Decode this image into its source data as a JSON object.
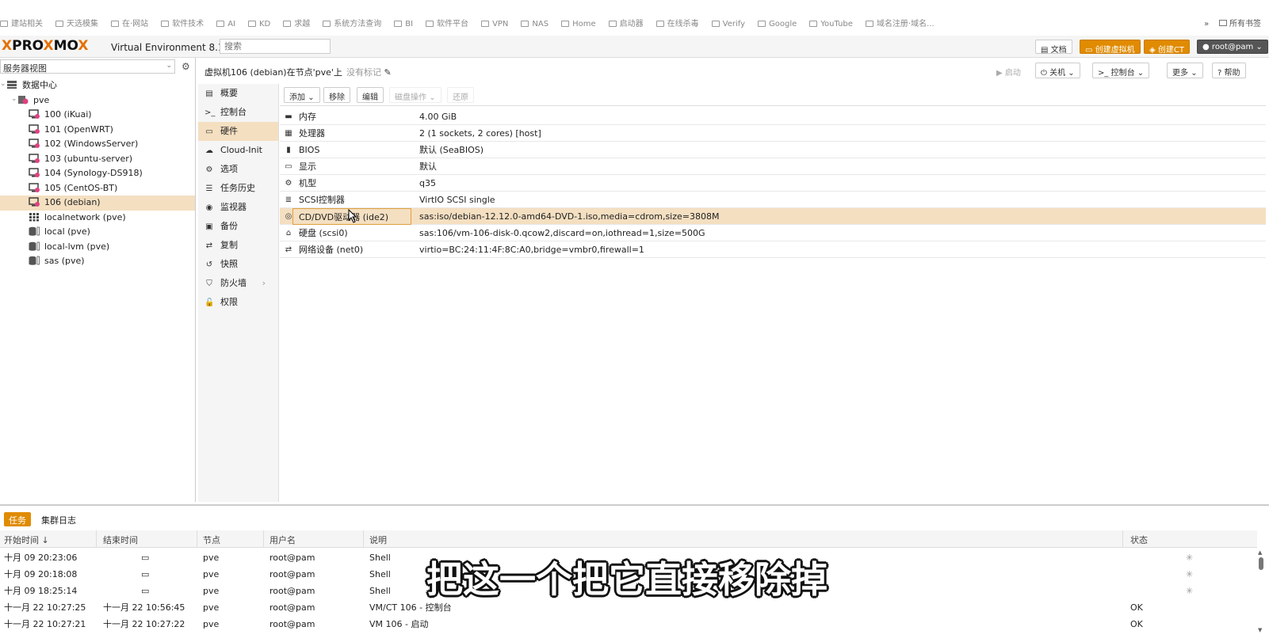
{
  "bookmarks": {
    "items": [
      "建站相关",
      "天选模集",
      "在·网站",
      "软件技术",
      "AI",
      "KD",
      "求越",
      "系统方法查询",
      "BI",
      "软件平台",
      "VPN",
      "NAS",
      "Home",
      "启动器",
      "在线杀毒",
      "Verify",
      "Google",
      "YouTube",
      "域名注册·域名..."
    ],
    "more": "»",
    "all_label": "所有书签"
  },
  "header": {
    "logo_prefix": "PRO",
    "logo_x1": "X",
    "logo_mid": "MO",
    "logo_x2": "X",
    "logo_lead": "X",
    "product": "Virtual Environment 8.1.4",
    "search_placeholder": "搜索",
    "doc_label": "文档",
    "create_vm_label": "创建虚拟机",
    "create_ct_label": "创建CT",
    "user_label": "root@pam"
  },
  "left": {
    "view_label": "服务器视图",
    "tree": [
      {
        "label": "数据中心",
        "icon": "datacenter-icon",
        "level": 0
      },
      {
        "label": "pve",
        "icon": "node-icon",
        "level": 1
      },
      {
        "label": "100 (iKuai)",
        "icon": "vm-icon",
        "level": 2
      },
      {
        "label": "101 (OpenWRT)",
        "icon": "vm-icon",
        "level": 2
      },
      {
        "label": "102 (WindowsServer)",
        "icon": "vm-icon",
        "level": 2
      },
      {
        "label": "103 (ubuntu-server)",
        "icon": "vm-icon",
        "level": 2
      },
      {
        "label": "104 (Synology-DS918)",
        "icon": "vm-icon",
        "level": 2
      },
      {
        "label": "105 (CentOS-BT)",
        "icon": "vm-icon",
        "level": 2
      },
      {
        "label": "106 (debian)",
        "icon": "vm-icon",
        "level": 2,
        "selected": true
      },
      {
        "label": "localnetwork (pve)",
        "icon": "network-icon",
        "level": 2
      },
      {
        "label": "local (pve)",
        "icon": "storage-icon",
        "level": 2
      },
      {
        "label": "local-lvm (pve)",
        "icon": "storage-icon",
        "level": 2
      },
      {
        "label": "sas (pve)",
        "icon": "storage-icon",
        "level": 2
      }
    ]
  },
  "content": {
    "title": "虚拟机106 (debian)在节点'pve'上",
    "no_tags": "没有标记",
    "start_label": "启动",
    "shutdown_label": "关机",
    "console_label": "控制台",
    "more_label": "更多",
    "help_label": "帮助"
  },
  "menu": [
    {
      "label": "概要",
      "icon": "summary-icon",
      "glyph": "▤"
    },
    {
      "label": "控制台",
      "icon": "console-icon",
      "glyph": ">_"
    },
    {
      "label": "硬件",
      "icon": "hardware-icon",
      "glyph": "▭",
      "selected": true
    },
    {
      "label": "Cloud-Init",
      "icon": "cloud-icon",
      "glyph": "☁"
    },
    {
      "label": "选项",
      "icon": "gear-icon",
      "glyph": "⚙"
    },
    {
      "label": "任务历史",
      "icon": "list-icon",
      "glyph": "☰"
    },
    {
      "label": "监视器",
      "icon": "eye-icon",
      "glyph": "◉"
    },
    {
      "label": "备份",
      "icon": "save-icon",
      "glyph": "▣"
    },
    {
      "label": "复制",
      "icon": "retweet-icon",
      "glyph": "⇄"
    },
    {
      "label": "快照",
      "icon": "history-icon",
      "glyph": "↺"
    },
    {
      "label": "防火墙",
      "icon": "shield-icon",
      "glyph": "⛉"
    },
    {
      "label": "权限",
      "icon": "unlock-icon",
      "glyph": "🔓"
    }
  ],
  "hardware": {
    "toolbar": {
      "add": "添加",
      "remove": "移除",
      "edit": "编辑",
      "disk_action": "磁盘操作",
      "revert": "还原"
    },
    "rows": [
      {
        "key": "内存",
        "value": "4.00 GiB",
        "icon": "memory-icon",
        "glyph": "▬"
      },
      {
        "key": "处理器",
        "value": "2 (1 sockets, 2 cores) [host]",
        "icon": "cpu-icon",
        "glyph": "▦"
      },
      {
        "key": "BIOS",
        "value": "默认 (SeaBIOS)",
        "icon": "bios-icon",
        "glyph": "▮"
      },
      {
        "key": "显示",
        "value": "默认",
        "icon": "display-icon",
        "glyph": "▭"
      },
      {
        "key": "机型",
        "value": "q35",
        "icon": "cogs-icon",
        "glyph": "⚙"
      },
      {
        "key": "SCSI控制器",
        "value": "VirtIO SCSI single",
        "icon": "database-icon",
        "glyph": "≣"
      },
      {
        "key": "CD/DVD驱动器 (ide2)",
        "value": "sas:iso/debian-12.12.0-amd64-DVD-1.iso,media=cdrom,size=3808M",
        "icon": "cdrom-icon",
        "glyph": "◎",
        "selected": true
      },
      {
        "key": "硬盘 (scsi0)",
        "value": "sas:106/vm-106-disk-0.qcow2,discard=on,iothread=1,size=500G",
        "icon": "harddisk-icon",
        "glyph": "⌂"
      },
      {
        "key": "网络设备 (net0)",
        "value": "virtio=BC:24:11:4F:8C:A0,bridge=vmbr0,firewall=1",
        "icon": "network-icon",
        "glyph": "⇄"
      }
    ]
  },
  "tasks": {
    "tab_tasks": "任务",
    "tab_cluster_log": "集群日志",
    "columns": {
      "start": "开始时间 ↓",
      "end": "结束时间",
      "node": "节点",
      "user": "用户名",
      "desc": "说明",
      "status": "状态"
    },
    "rows": [
      {
        "start": "十月 09 20:23:06",
        "end": "",
        "running": true,
        "node": "pve",
        "user": "root@pam",
        "desc": "Shell",
        "status": ""
      },
      {
        "start": "十月 09 20:18:08",
        "end": "",
        "running": true,
        "node": "pve",
        "user": "root@pam",
        "desc": "Shell",
        "status": ""
      },
      {
        "start": "十月 09 18:25:14",
        "end": "",
        "running": true,
        "node": "pve",
        "user": "root@pam",
        "desc": "Shell",
        "status": ""
      },
      {
        "start": "十一月 22 10:27:25",
        "end": "十一月 22 10:56:45",
        "running": false,
        "node": "pve",
        "user": "root@pam",
        "desc": "VM/CT 106 - 控制台",
        "status": "OK"
      },
      {
        "start": "十一月 22 10:27:21",
        "end": "十一月 22 10:27:22",
        "running": false,
        "node": "pve",
        "user": "root@pam",
        "desc": "VM 106 - 启动",
        "status": "OK"
      }
    ]
  },
  "subtitle": "把这一个把它直接移除掉",
  "colors": {
    "accent": "#e08b00",
    "selected_row": "#f4dfc1",
    "header_bg": "#f5f5f5"
  }
}
